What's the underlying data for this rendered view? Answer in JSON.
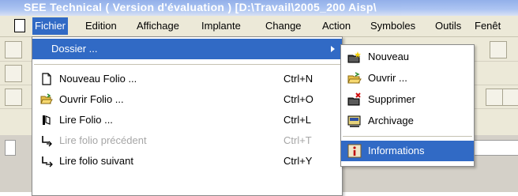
{
  "window": {
    "title": "SEE Technical ( Version d'évaluation ) [D:\\Travail\\2005_200 Aisp\\"
  },
  "menubar": {
    "items": [
      {
        "label": "Fichier"
      },
      {
        "label": "Edition"
      },
      {
        "label": "Affichage"
      },
      {
        "label": "Implante"
      },
      {
        "label": "Change"
      },
      {
        "label": "Action"
      },
      {
        "label": "Symboles"
      },
      {
        "label": "Outils"
      },
      {
        "label": "Fenêt"
      }
    ]
  },
  "file_menu": {
    "items": [
      {
        "label": "Dossier ...",
        "shortcut": "",
        "icon": "none",
        "state": "highlighted-submenu"
      },
      {
        "label": "Nouveau Folio ...",
        "shortcut": "Ctrl+N",
        "icon": "new-page-icon",
        "state": "enabled"
      },
      {
        "label": "Ouvrir Folio ...",
        "shortcut": "Ctrl+O",
        "icon": "open-folder-icon",
        "state": "enabled"
      },
      {
        "label": "Lire Folio ...",
        "shortcut": "Ctrl+L",
        "icon": "read-folio-icon",
        "state": "enabled"
      },
      {
        "label": "Lire folio précédent",
        "shortcut": "Ctrl+T",
        "icon": "previous-folio-icon",
        "state": "disabled"
      },
      {
        "label": "Lire folio suivant",
        "shortcut": "Ctrl+Y",
        "icon": "next-folio-icon",
        "state": "enabled"
      }
    ]
  },
  "dossier_submenu": {
    "items": [
      {
        "label": "Nouveau",
        "icon": "new-folder-icon"
      },
      {
        "label": "Ouvrir ...",
        "icon": "open-folder-icon"
      },
      {
        "label": "Supprimer",
        "icon": "delete-folder-icon"
      },
      {
        "label": "Archivage",
        "icon": "archive-icon"
      },
      {
        "label": "Informations",
        "icon": "info-icon",
        "state": "highlighted"
      }
    ]
  },
  "colors": {
    "highlight": "#316ac5",
    "menubar": "#ece9d8",
    "disabled_text": "#a6a6a6"
  }
}
